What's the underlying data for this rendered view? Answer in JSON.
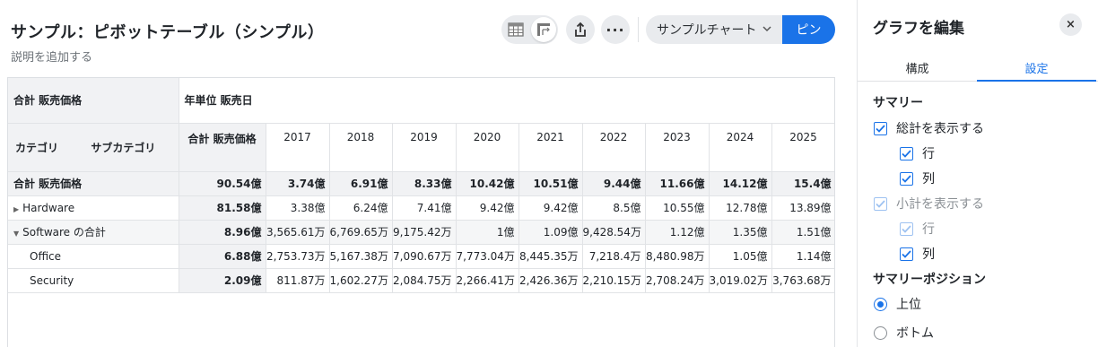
{
  "header": {
    "title": "サンプル：ピボットテーブル（シンプル）",
    "subtitle": "説明を追加する",
    "more_label": "···",
    "chart_select": "サンプルチャート",
    "pin_label": "ピン"
  },
  "pivot": {
    "corner_label": "合計 販売価格",
    "column_group_label": "年単位 販売日",
    "row_header_category": "カテゴリ",
    "row_header_subcategory": "サブカテゴリ",
    "total_column_label": "合計 販売価格",
    "years": [
      "2017",
      "2018",
      "2019",
      "2020",
      "2021",
      "2022",
      "2023",
      "2024",
      "2025"
    ],
    "rows": [
      {
        "label": "合計 販売価格",
        "total": "90.54億",
        "values": [
          "3.74億",
          "6.91億",
          "8.33億",
          "10.42億",
          "10.51億",
          "9.44億",
          "11.66億",
          "14.12億",
          "15.4億"
        ]
      },
      {
        "label": "Hardware",
        "total": "81.58億",
        "values": [
          "3.38億",
          "6.24億",
          "7.41億",
          "9.42億",
          "9.42億",
          "8.5億",
          "10.55億",
          "12.78億",
          "13.89億"
        ]
      },
      {
        "label": "Software の合計",
        "total": "8.96億",
        "values": [
          "3,565.61万",
          "6,769.65万",
          "9,175.42万",
          "1億",
          "1.09億",
          "9,428.54万",
          "1.12億",
          "1.35億",
          "1.51億"
        ]
      },
      {
        "label": "Office",
        "total": "6.88億",
        "values": [
          "2,753.73万",
          "5,167.38万",
          "7,090.67万",
          "7,773.04万",
          "8,445.35万",
          "7,218.4万",
          "8,480.98万",
          "1.05億",
          "1.14億"
        ]
      },
      {
        "label": "Security",
        "total": "2.09億",
        "values": [
          "811.87万",
          "1,602.27万",
          "2,084.75万",
          "2,266.41万",
          "2,426.36万",
          "2,210.15万",
          "2,708.24万",
          "3,019.02万",
          "3,763.68万"
        ]
      }
    ]
  },
  "panel": {
    "title": "グラフを編集",
    "close_label": "×",
    "tabs": [
      "構成",
      "設定"
    ],
    "active_tab": "設定",
    "summary_section": "サマリー",
    "show_totals": "総計を表示する",
    "row_label": "行",
    "col_label": "列",
    "show_subtotals": "小計を表示する",
    "sub_row_label": "行",
    "sub_col_label": "列",
    "position_section": "サマリーポジション",
    "position_top": "上位",
    "position_bottom": "ボトム",
    "accent": "#1a73e8"
  }
}
